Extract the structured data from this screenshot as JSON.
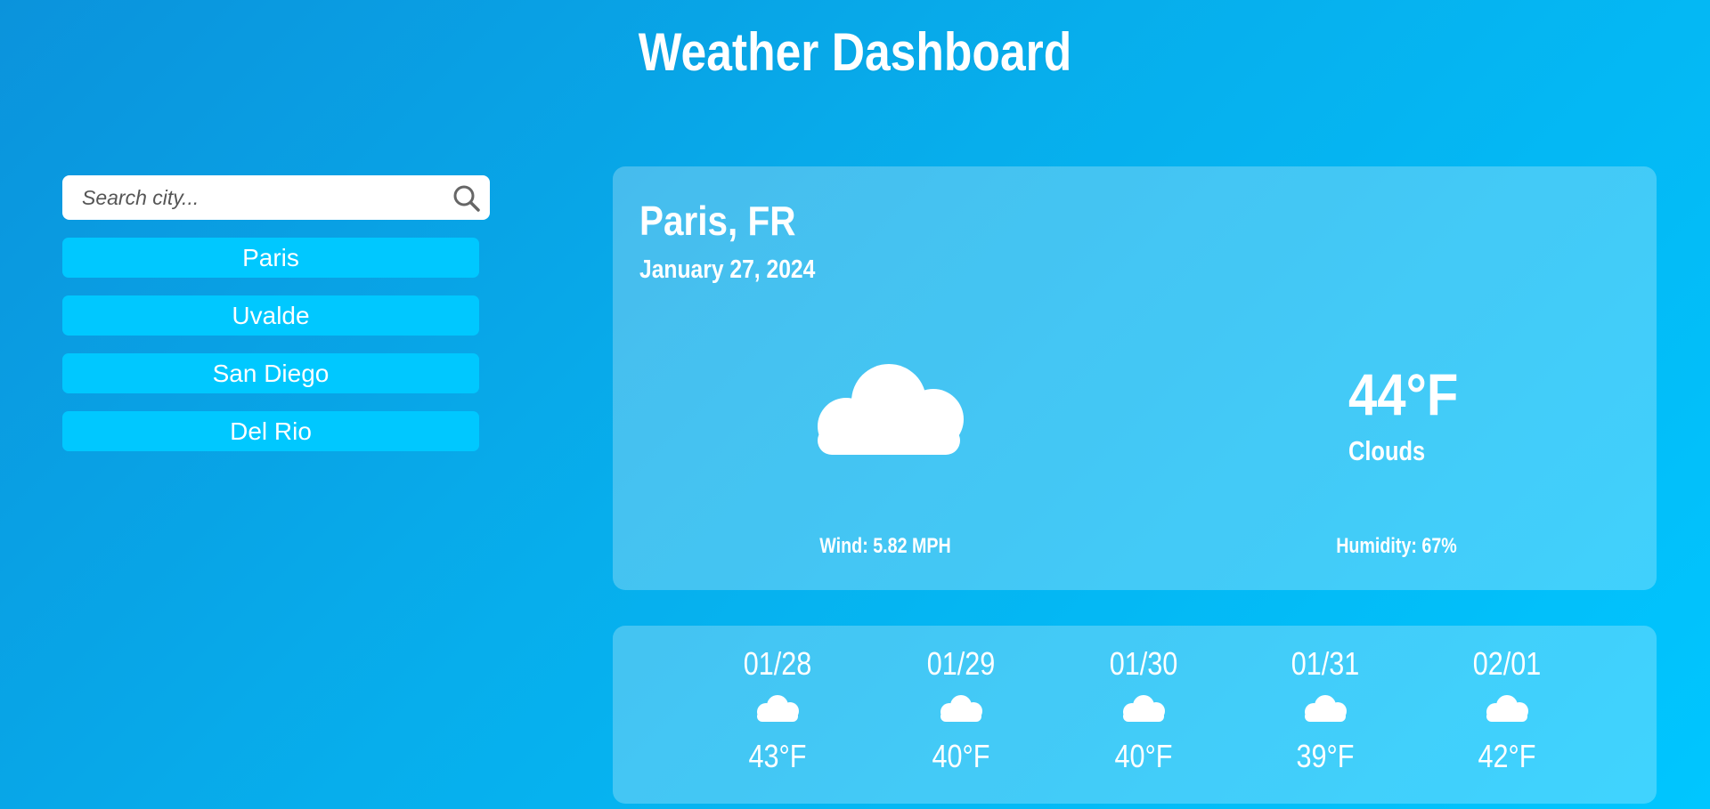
{
  "header": {
    "title": "Weather Dashboard"
  },
  "search": {
    "placeholder": "Search city...",
    "value": "",
    "icon": "search-icon"
  },
  "history": {
    "items": [
      {
        "label": "Paris"
      },
      {
        "label": "Uvalde"
      },
      {
        "label": "San Diego"
      },
      {
        "label": "Del Rio"
      }
    ]
  },
  "current": {
    "city": "Paris, FR",
    "date": "January 27, 2024",
    "icon": "cloud-icon",
    "temperature": "44°F",
    "description": "Clouds",
    "wind": "Wind: 5.82 MPH",
    "humidity": "Humidity: 67%"
  },
  "forecast": {
    "days": [
      {
        "date": "01/28",
        "icon": "cloud-icon",
        "temp": "43°F"
      },
      {
        "date": "01/29",
        "icon": "cloud-icon",
        "temp": "40°F"
      },
      {
        "date": "01/30",
        "icon": "cloud-icon",
        "temp": "40°F"
      },
      {
        "date": "01/31",
        "icon": "cloud-icon",
        "temp": "39°F"
      },
      {
        "date": "02/01",
        "icon": "cloud-icon",
        "temp": "42°F"
      }
    ]
  },
  "colors": {
    "background_start": "#0b93dc",
    "background_end": "#00c6ff",
    "city_button": "#00c8ff",
    "card": "rgba(255,255,255,0.25)",
    "text": "#ffffff"
  }
}
